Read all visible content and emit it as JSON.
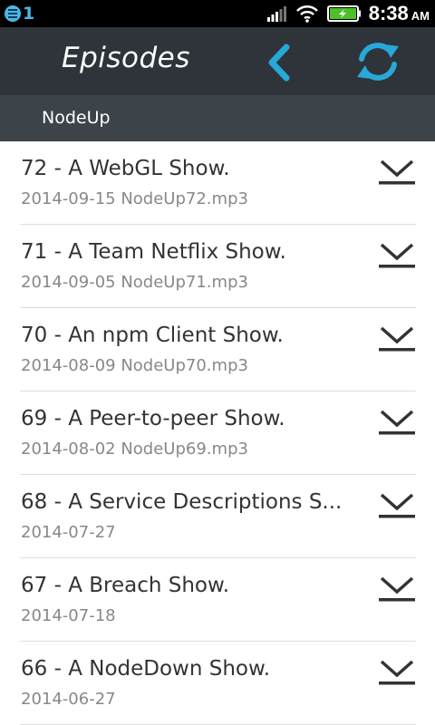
{
  "status_bar": {
    "notification_count": "1",
    "time": "8:38",
    "ampm": "AM"
  },
  "header": {
    "title": "Episodes"
  },
  "subheader": {
    "title": "NodeUp"
  },
  "episodes": [
    {
      "title": "72 - A WebGL Show.",
      "subtitle": "2014-09-15 NodeUp72.mp3"
    },
    {
      "title": "71 - A Team Netflix Show.",
      "subtitle": "2014-09-05 NodeUp71.mp3"
    },
    {
      "title": "70 - An npm Client Show.",
      "subtitle": "2014-08-09 NodeUp70.mp3"
    },
    {
      "title": "69 - A Peer-to-peer Show.",
      "subtitle": "2014-08-02 NodeUp69.mp3"
    },
    {
      "title": "68 - A Service Descriptions S...",
      "subtitle": "2014-07-27"
    },
    {
      "title": "67 - A Breach Show.",
      "subtitle": "2014-07-18"
    },
    {
      "title": "66 - A NodeDown Show.",
      "subtitle": "2014-06-27"
    }
  ],
  "colors": {
    "accent": "#27a8d8",
    "header_bg": "#2e3439",
    "subheader_bg": "#3d4449",
    "title_text": "#333333",
    "subtitle_text": "#888888"
  }
}
